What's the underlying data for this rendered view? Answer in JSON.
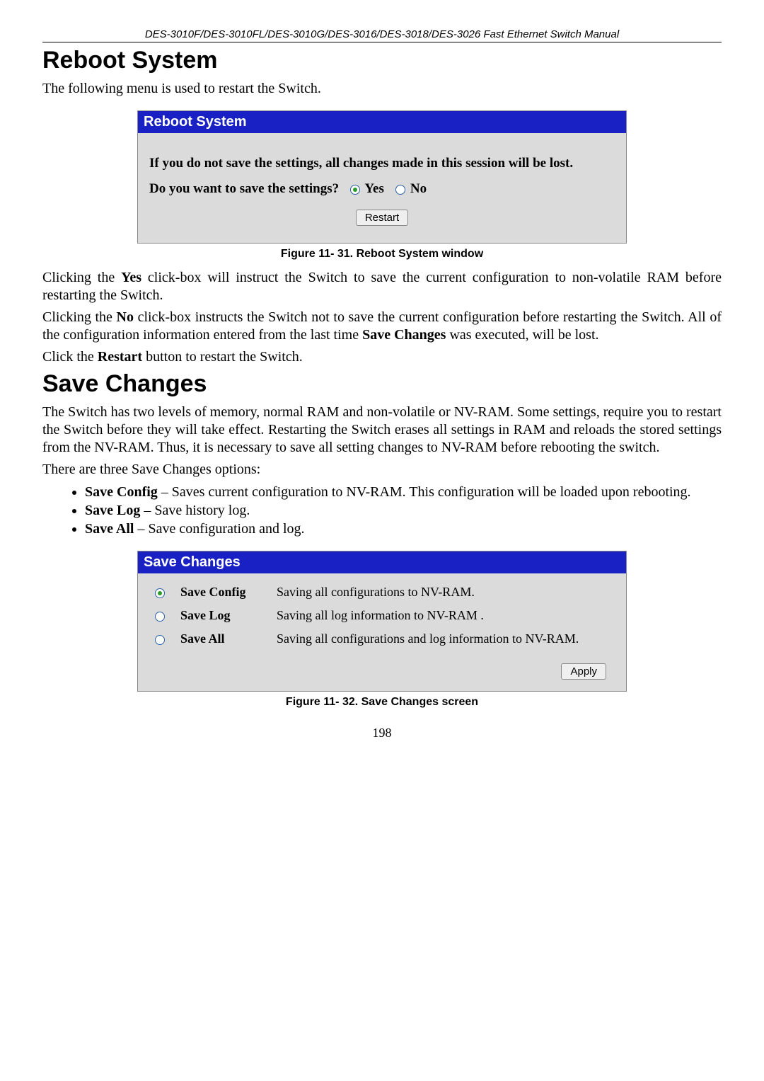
{
  "header": {
    "running_title": "DES-3010F/DES-3010FL/DES-3010G/DES-3016/DES-3018/DES-3026 Fast Ethernet Switch Manual"
  },
  "section1": {
    "heading": "Reboot System",
    "intro": "The following menu is used to restart the Switch.",
    "panel_title": "Reboot System",
    "warning_line": "If you do not save the settings, all changes made in this session will be lost.",
    "question_prefix": "Do you want to save the settings?",
    "yes_label": "Yes",
    "no_label": "No",
    "restart_btn": "Restart",
    "caption": "Figure 11- 31. Reboot System window",
    "para1_a": "Clicking the ",
    "para1_b": "Yes",
    "para1_c": " click-box will instruct the Switch to save the current configuration to non-volatile RAM before restarting the Switch.",
    "para2_a": "Clicking the ",
    "para2_b": "No",
    "para2_c": " click-box instructs the Switch not to save the current configuration before restarting the Switch. All of the configuration information entered from the last time ",
    "para2_d": "Save Changes",
    "para2_e": " was executed, will be lost.",
    "para3_a": "Click the ",
    "para3_b": "Restart",
    "para3_c": " button to restart the Switch."
  },
  "section2": {
    "heading": "Save Changes",
    "intro": "The Switch has two levels of memory, normal RAM and non-volatile or NV-RAM. Some settings, require you to restart the Switch before they will take effect. Restarting the Switch erases all settings in RAM and reloads the stored settings from the NV-RAM. Thus, it is necessary to save all setting changes to NV-RAM before rebooting the switch.",
    "options_intro": "There are three Save Changes options:",
    "bullets": [
      {
        "strong": "Save Config",
        "rest": " – Saves current configuration to NV-RAM. This configuration will be loaded upon rebooting."
      },
      {
        "strong": "Save Log",
        "rest": " – Save history log."
      },
      {
        "strong": "Save All",
        "rest": " – Save configuration and log."
      }
    ],
    "panel_title": "Save Changes",
    "rows": [
      {
        "selected": true,
        "name": "Save Config",
        "desc": "Saving all configurations to NV-RAM."
      },
      {
        "selected": false,
        "name": "Save Log",
        "desc": "Saving all log information to NV-RAM ."
      },
      {
        "selected": false,
        "name": "Save All",
        "desc": "Saving all configurations and log information to NV-RAM."
      }
    ],
    "apply_btn": "Apply",
    "caption": "Figure 11- 32.  Save Changes screen"
  },
  "footer": {
    "page_num": "198"
  }
}
